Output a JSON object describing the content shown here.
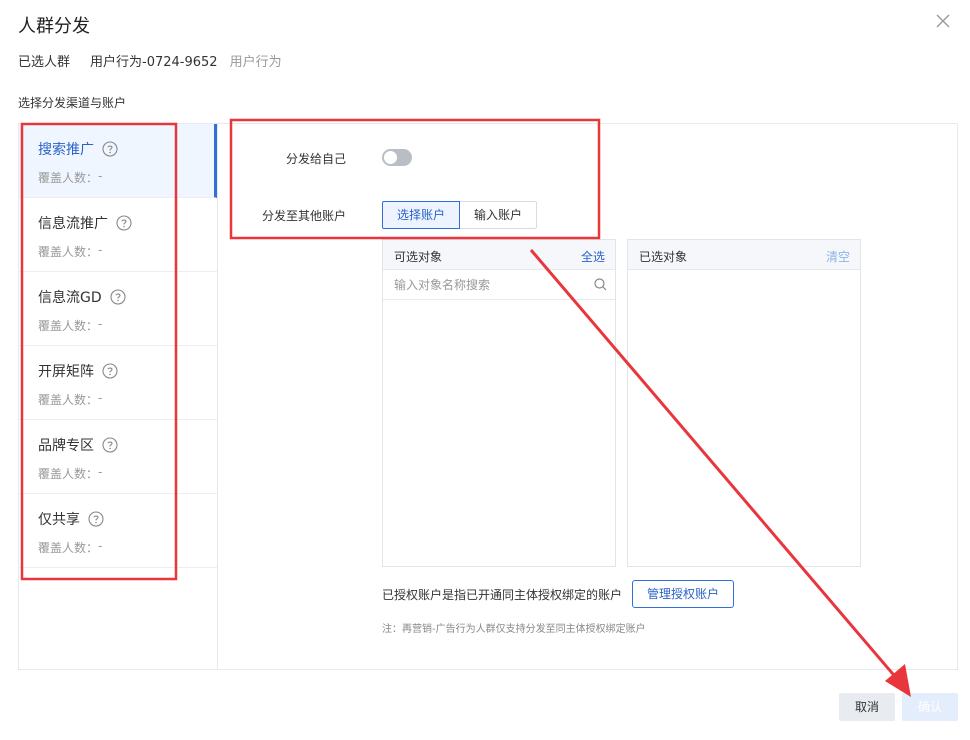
{
  "dialog": {
    "title": "人群分发",
    "selected_crowd_label": "已选人群",
    "crowd_name": "用户行为-0724-9652",
    "crowd_type": "用户行为",
    "section_label": "选择分发渠道与账户"
  },
  "channels": [
    {
      "name": "搜索推广",
      "cover_label": "覆盖人数：",
      "cover_value": "-",
      "active": true
    },
    {
      "name": "信息流推广",
      "cover_label": "覆盖人数：",
      "cover_value": "-",
      "active": false
    },
    {
      "name": "信息流GD",
      "cover_label": "覆盖人数：",
      "cover_value": "-",
      "active": false
    },
    {
      "name": "开屏矩阵",
      "cover_label": "覆盖人数：",
      "cover_value": "-",
      "active": false
    },
    {
      "name": "品牌专区",
      "cover_label": "覆盖人数：",
      "cover_value": "-",
      "active": false
    },
    {
      "name": "仅共享",
      "cover_label": "覆盖人数：",
      "cover_value": "-",
      "active": false
    }
  ],
  "form": {
    "self_label": "分发给自己",
    "self_enabled": false,
    "others_label": "分发至其他账户",
    "select_account": "选择账户",
    "input_account": "输入账户"
  },
  "available": {
    "title": "可选对象",
    "select_all": "全选",
    "search_placeholder": "输入对象名称搜索"
  },
  "selected": {
    "title": "已选对象",
    "clear": "清空"
  },
  "auth": {
    "text": "已授权账户是指已开通同主体授权绑定的账户",
    "manage_button": "管理授权账户",
    "note": "注：再营销-广告行为人群仅支持分发至同主体授权绑定账户"
  },
  "footer": {
    "cancel": "取消",
    "confirm": "确认"
  },
  "colors": {
    "accent": "#2f6fd8",
    "annotation_red": "#e8363c"
  }
}
